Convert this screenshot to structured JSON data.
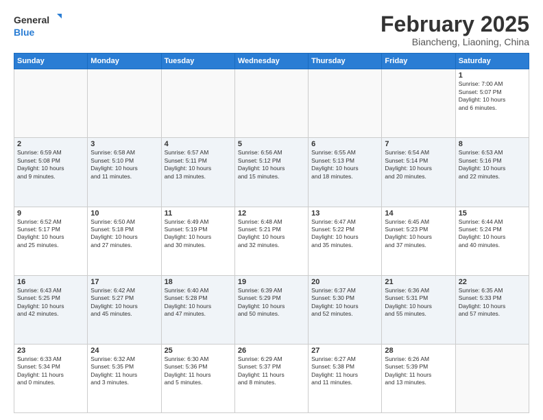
{
  "header": {
    "logo_general": "General",
    "logo_blue": "Blue",
    "month_title": "February 2025",
    "subtitle": "Biancheng, Liaoning, China"
  },
  "weekdays": [
    "Sunday",
    "Monday",
    "Tuesday",
    "Wednesday",
    "Thursday",
    "Friday",
    "Saturday"
  ],
  "weeks": [
    [
      {
        "day": "",
        "info": ""
      },
      {
        "day": "",
        "info": ""
      },
      {
        "day": "",
        "info": ""
      },
      {
        "day": "",
        "info": ""
      },
      {
        "day": "",
        "info": ""
      },
      {
        "day": "",
        "info": ""
      },
      {
        "day": "1",
        "info": "Sunrise: 7:00 AM\nSunset: 5:07 PM\nDaylight: 10 hours\nand 6 minutes."
      }
    ],
    [
      {
        "day": "2",
        "info": "Sunrise: 6:59 AM\nSunset: 5:08 PM\nDaylight: 10 hours\nand 9 minutes."
      },
      {
        "day": "3",
        "info": "Sunrise: 6:58 AM\nSunset: 5:10 PM\nDaylight: 10 hours\nand 11 minutes."
      },
      {
        "day": "4",
        "info": "Sunrise: 6:57 AM\nSunset: 5:11 PM\nDaylight: 10 hours\nand 13 minutes."
      },
      {
        "day": "5",
        "info": "Sunrise: 6:56 AM\nSunset: 5:12 PM\nDaylight: 10 hours\nand 15 minutes."
      },
      {
        "day": "6",
        "info": "Sunrise: 6:55 AM\nSunset: 5:13 PM\nDaylight: 10 hours\nand 18 minutes."
      },
      {
        "day": "7",
        "info": "Sunrise: 6:54 AM\nSunset: 5:14 PM\nDaylight: 10 hours\nand 20 minutes."
      },
      {
        "day": "8",
        "info": "Sunrise: 6:53 AM\nSunset: 5:16 PM\nDaylight: 10 hours\nand 22 minutes."
      }
    ],
    [
      {
        "day": "9",
        "info": "Sunrise: 6:52 AM\nSunset: 5:17 PM\nDaylight: 10 hours\nand 25 minutes."
      },
      {
        "day": "10",
        "info": "Sunrise: 6:50 AM\nSunset: 5:18 PM\nDaylight: 10 hours\nand 27 minutes."
      },
      {
        "day": "11",
        "info": "Sunrise: 6:49 AM\nSunset: 5:19 PM\nDaylight: 10 hours\nand 30 minutes."
      },
      {
        "day": "12",
        "info": "Sunrise: 6:48 AM\nSunset: 5:21 PM\nDaylight: 10 hours\nand 32 minutes."
      },
      {
        "day": "13",
        "info": "Sunrise: 6:47 AM\nSunset: 5:22 PM\nDaylight: 10 hours\nand 35 minutes."
      },
      {
        "day": "14",
        "info": "Sunrise: 6:45 AM\nSunset: 5:23 PM\nDaylight: 10 hours\nand 37 minutes."
      },
      {
        "day": "15",
        "info": "Sunrise: 6:44 AM\nSunset: 5:24 PM\nDaylight: 10 hours\nand 40 minutes."
      }
    ],
    [
      {
        "day": "16",
        "info": "Sunrise: 6:43 AM\nSunset: 5:25 PM\nDaylight: 10 hours\nand 42 minutes."
      },
      {
        "day": "17",
        "info": "Sunrise: 6:42 AM\nSunset: 5:27 PM\nDaylight: 10 hours\nand 45 minutes."
      },
      {
        "day": "18",
        "info": "Sunrise: 6:40 AM\nSunset: 5:28 PM\nDaylight: 10 hours\nand 47 minutes."
      },
      {
        "day": "19",
        "info": "Sunrise: 6:39 AM\nSunset: 5:29 PM\nDaylight: 10 hours\nand 50 minutes."
      },
      {
        "day": "20",
        "info": "Sunrise: 6:37 AM\nSunset: 5:30 PM\nDaylight: 10 hours\nand 52 minutes."
      },
      {
        "day": "21",
        "info": "Sunrise: 6:36 AM\nSunset: 5:31 PM\nDaylight: 10 hours\nand 55 minutes."
      },
      {
        "day": "22",
        "info": "Sunrise: 6:35 AM\nSunset: 5:33 PM\nDaylight: 10 hours\nand 57 minutes."
      }
    ],
    [
      {
        "day": "23",
        "info": "Sunrise: 6:33 AM\nSunset: 5:34 PM\nDaylight: 11 hours\nand 0 minutes."
      },
      {
        "day": "24",
        "info": "Sunrise: 6:32 AM\nSunset: 5:35 PM\nDaylight: 11 hours\nand 3 minutes."
      },
      {
        "day": "25",
        "info": "Sunrise: 6:30 AM\nSunset: 5:36 PM\nDaylight: 11 hours\nand 5 minutes."
      },
      {
        "day": "26",
        "info": "Sunrise: 6:29 AM\nSunset: 5:37 PM\nDaylight: 11 hours\nand 8 minutes."
      },
      {
        "day": "27",
        "info": "Sunrise: 6:27 AM\nSunset: 5:38 PM\nDaylight: 11 hours\nand 11 minutes."
      },
      {
        "day": "28",
        "info": "Sunrise: 6:26 AM\nSunset: 5:39 PM\nDaylight: 11 hours\nand 13 minutes."
      },
      {
        "day": "",
        "info": ""
      }
    ]
  ]
}
